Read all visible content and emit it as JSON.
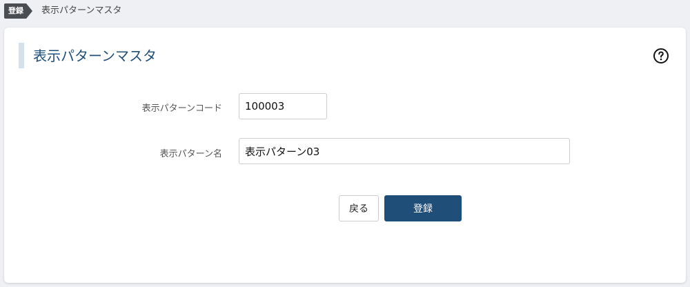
{
  "breadcrumb": {
    "tag": "登録",
    "page": "表示パターンマスタ"
  },
  "header": {
    "title": "表示パターンマスタ",
    "help_icon": "question-circle-icon"
  },
  "form": {
    "code_label": "表示パターンコード",
    "code_value": "100003",
    "name_label": "表示パターン名",
    "name_value": "表示パターン03"
  },
  "actions": {
    "back_label": "戻る",
    "register_label": "登録"
  },
  "colors": {
    "accent": "#1f4e79",
    "title_bar": "#d3e1ed",
    "background": "#eef0f3"
  }
}
